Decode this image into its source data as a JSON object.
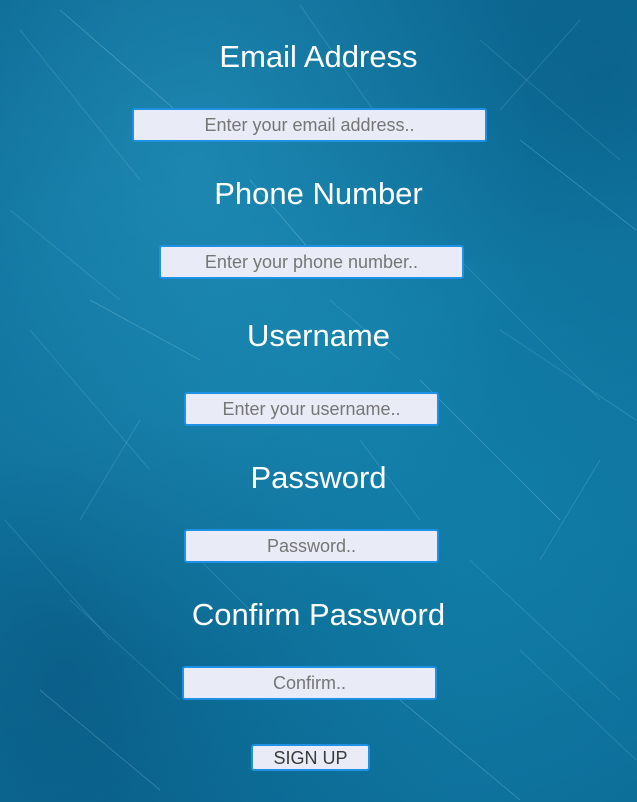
{
  "form": {
    "email": {
      "label": "Email Address",
      "placeholder": "Enter your email address.."
    },
    "phone": {
      "label": "Phone Number",
      "placeholder": "Enter your phone number.."
    },
    "username": {
      "label": "Username",
      "placeholder": "Enter your username.."
    },
    "password": {
      "label": "Password",
      "placeholder": "Password.."
    },
    "confirm": {
      "label": "Confirm Password",
      "placeholder": "Confirm.."
    },
    "submit_label": "SIGN UP"
  },
  "colors": {
    "background": "#0d6f97",
    "field_border": "#1e90e6",
    "field_background": "#e9ebf7",
    "label_text": "#ffffff"
  }
}
